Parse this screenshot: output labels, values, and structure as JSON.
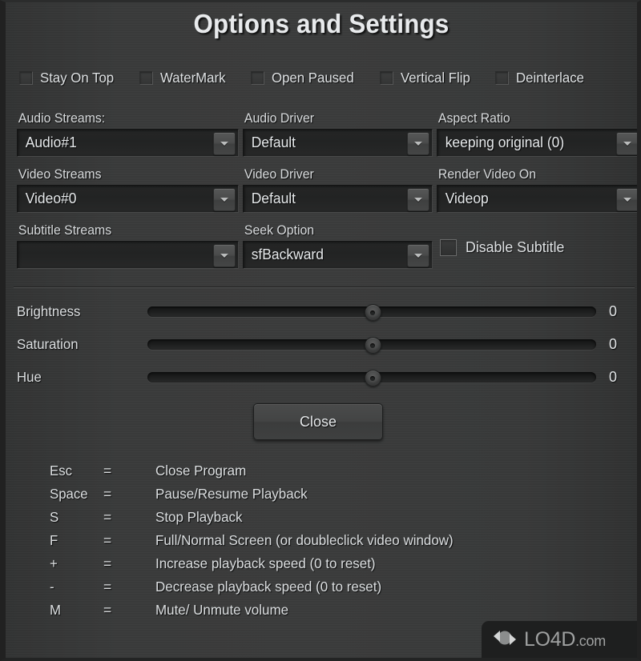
{
  "window": {
    "title": "Options and Settings"
  },
  "top_checkboxes": [
    {
      "label": "Stay On Top",
      "checked": false,
      "name": "stay-on-top"
    },
    {
      "label": "WaterMark",
      "checked": false,
      "name": "watermark"
    },
    {
      "label": "Open Paused",
      "checked": false,
      "name": "open-paused"
    },
    {
      "label": "Vertical Flip",
      "checked": false,
      "name": "vertical-flip"
    },
    {
      "label": "Deinterlace",
      "checked": false,
      "name": "deinterlace"
    }
  ],
  "fields": {
    "audio_streams": {
      "label": "Audio Streams:",
      "value": "Audio#1"
    },
    "video_streams": {
      "label": "Video Streams",
      "value": "Video#0"
    },
    "subtitle_streams": {
      "label": "Subtitle Streams",
      "value": ""
    },
    "audio_driver": {
      "label": "Audio Driver",
      "value": "Default"
    },
    "video_driver": {
      "label": "Video Driver",
      "value": "Default"
    },
    "seek_option": {
      "label": "Seek Option",
      "value": "sfBackward"
    },
    "aspect_ratio": {
      "label": "Aspect Ratio",
      "value": "keeping original (0)"
    },
    "render_video_on": {
      "label": "Render Video On",
      "value": "Videop"
    },
    "disable_subtitle": {
      "label": "Disable Subtitle",
      "checked": false
    }
  },
  "sliders": [
    {
      "label": "Brightness",
      "value": "0",
      "percent": 50
    },
    {
      "label": "Saturation",
      "value": "0",
      "percent": 50
    },
    {
      "label": "Hue",
      "value": "0",
      "percent": 50
    }
  ],
  "buttons": {
    "close": "Close"
  },
  "shortcuts": {
    "separator": "=",
    "rows": [
      {
        "key": "Esc",
        "eq": "=",
        "desc": "Close Program"
      },
      {
        "key": "Space",
        "eq": "=",
        "desc": "Pause/Resume Playback"
      },
      {
        "key": "S",
        "eq": "=",
        "desc": "Stop Playback"
      },
      {
        "key": "F",
        "eq": "=",
        "desc": "Full/Normal Screen (or doubleclick video window)"
      },
      {
        "key": "+",
        "eq": "=",
        "desc": "Increase playback speed (0 to reset)"
      },
      {
        "key": "-",
        "eq": "=",
        "desc": "Decrease playback speed (0 to reset)"
      },
      {
        "key": "M",
        "eq": "=",
        "desc": "Mute/ Unmute volume"
      }
    ]
  },
  "watermark": {
    "brand": "LO4D",
    "suffix": ".com"
  },
  "colors": {
    "background": "#3a3b3b",
    "field_background": "#232424",
    "text": "#dfe2e4",
    "border": "#1d1e1e"
  }
}
